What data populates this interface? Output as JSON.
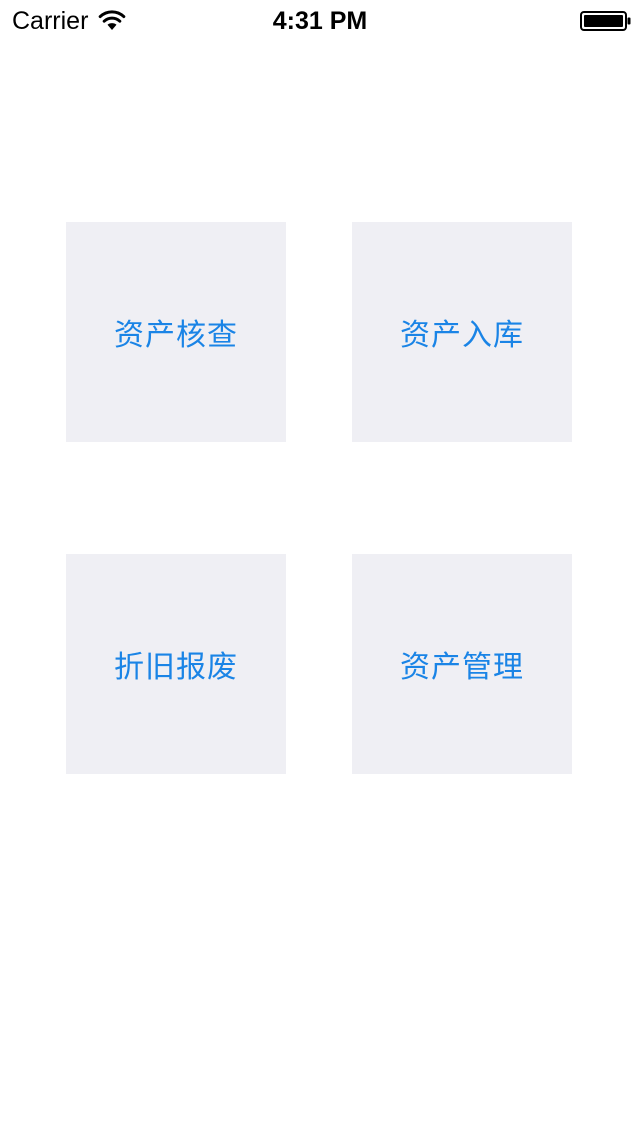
{
  "status_bar": {
    "carrier": "Carrier",
    "wifi_icon": "wifi-icon",
    "time": "4:31 PM",
    "battery_icon": "battery-icon"
  },
  "menu": {
    "items": [
      {
        "label": "资产核查"
      },
      {
        "label": "资产入库"
      },
      {
        "label": "折旧报废"
      },
      {
        "label": "资产管理"
      }
    ]
  },
  "colors": {
    "tile_background": "#efeff4",
    "label_color": "#1a84e6",
    "page_background": "#ffffff"
  }
}
